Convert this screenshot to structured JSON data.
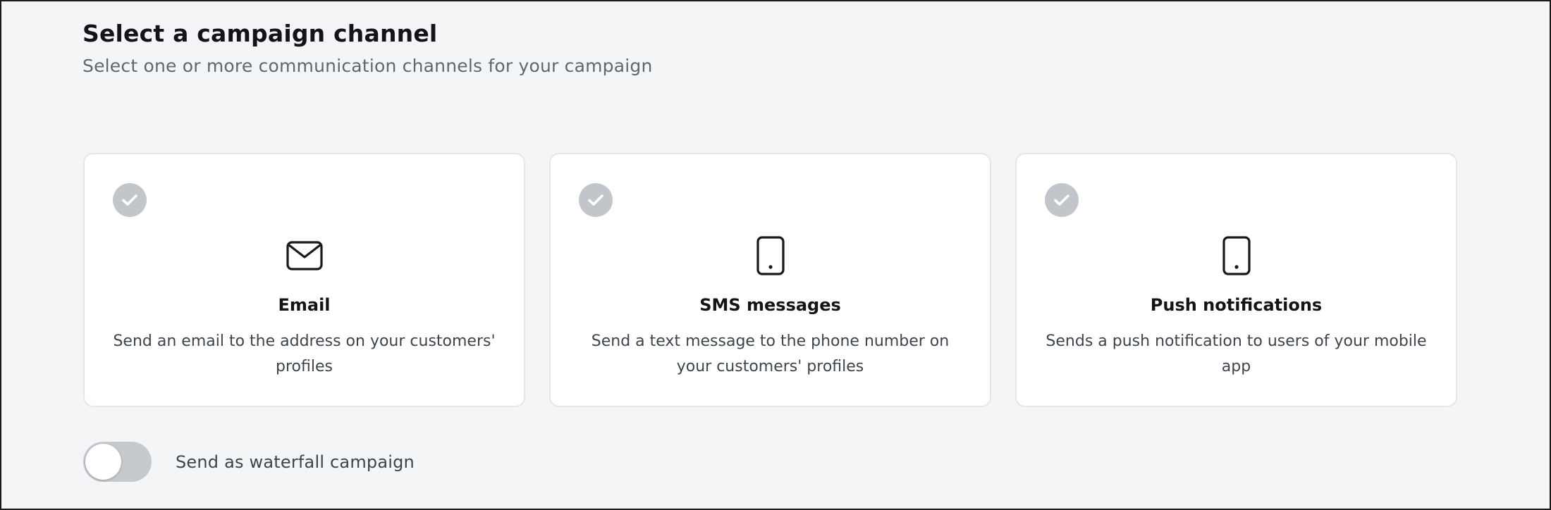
{
  "header": {
    "title": "Select a campaign channel",
    "subtitle": "Select one or more communication channels for your campaign"
  },
  "channels": [
    {
      "icon": "envelope-icon",
      "title": "Email",
      "description": "Send an email to the address on your customers' profiles",
      "selected": false
    },
    {
      "icon": "mobile-phone-icon",
      "title": "SMS messages",
      "description": "Send a text message to the phone number on your customers' profiles",
      "selected": false
    },
    {
      "icon": "mobile-phone-icon",
      "title": "Push notifications",
      "description": "Sends a push notification to users of your mobile app",
      "selected": false
    }
  ],
  "waterfall": {
    "label": "Send as waterfall campaign",
    "enabled": false
  },
  "colors": {
    "background": "#f4f5f7",
    "card_border": "#e4e6ea",
    "check_inactive": "#c2c6cb",
    "toggle_off": "#c6cacf"
  }
}
